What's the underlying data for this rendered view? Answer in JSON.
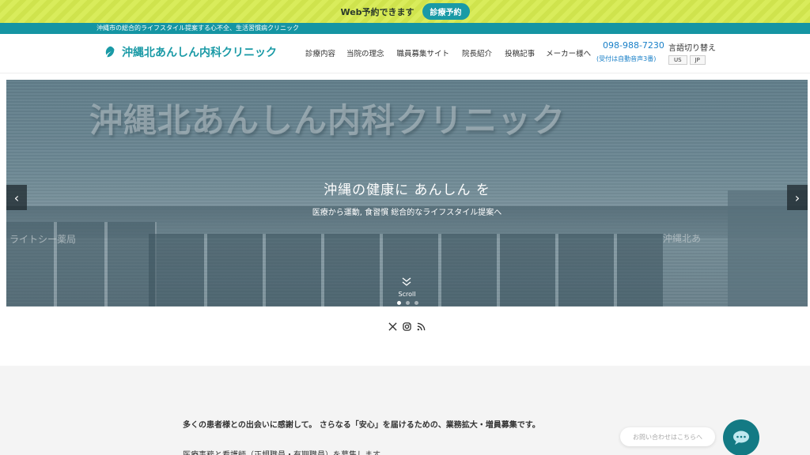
{
  "promo": {
    "text": "Web予約できます",
    "button": "診療予約"
  },
  "tagline": "沖縄市の総合的ライフスタイル提案する心不全、生活習慣病クリニック",
  "header": {
    "logo_text": "沖縄北あんしん内科クリニック",
    "nav": [
      "診療内容",
      "当院の理念",
      "職員募集サイト",
      "院長紹介",
      "投稿記事",
      "メーカー様へ"
    ],
    "phone": "098-988-7230",
    "phone_note": "(受付は自動音声3番)",
    "lang_label": "言語切り替え",
    "lang_options": [
      "US",
      "JP"
    ]
  },
  "hero": {
    "signboard": "沖縄北あんしん内科クリニック",
    "sign_left": "ライトシー薬局",
    "sign_right": "沖縄北あ",
    "title": "沖縄の健康に あんしん を",
    "subtitle": "医療から運動, 食習慣 総合的なライフスタイル提案へ",
    "scroll": "Scroll",
    "prev": "‹",
    "next": "›"
  },
  "social": [
    "x-icon",
    "instagram-icon",
    "rss-icon"
  ],
  "content": {
    "intro": "多くの患者様との出会いに感謝して。 さらなる「安心」を届けるための、業務拡大・増員募集です。",
    "intro2": "医療事務と看護師（正規職員・有期職員）を募集します"
  },
  "chat": {
    "placeholder": "お問い合わせはこちらへ"
  },
  "colors": {
    "accent": "#1a9aa6",
    "promo_bg": "#d9ec5b",
    "tagline_bg": "#1595a3",
    "chat_btn": "#137a84"
  }
}
